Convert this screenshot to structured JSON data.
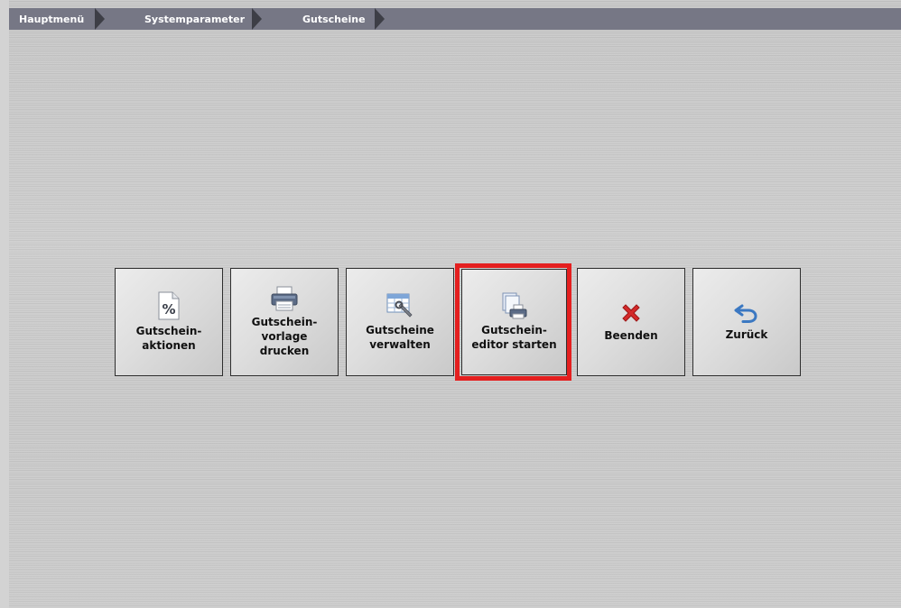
{
  "breadcrumb": {
    "items": [
      {
        "label": "Hauptmenü"
      },
      {
        "label": "Systemparameter"
      },
      {
        "label": "Gutscheine"
      }
    ]
  },
  "tiles": [
    {
      "label": "Gutschein-\naktionen",
      "icon": "percent-document-icon"
    },
    {
      "label": "Gutschein-\nvorlage\ndrucken",
      "icon": "printer-icon"
    },
    {
      "label": "Gutscheine\nverwalten",
      "icon": "table-wrench-icon"
    },
    {
      "label": "Gutschein-\neditor starten",
      "icon": "document-printer-icon"
    },
    {
      "label": "Beenden",
      "icon": "red-x-icon"
    },
    {
      "label": "Zurück",
      "icon": "undo-arrow-icon"
    }
  ],
  "colors": {
    "breadcrumb_bg": "#767785",
    "highlight": "#e41f1f",
    "close_red": "#d42a2a",
    "back_blue": "#3b78c2"
  }
}
